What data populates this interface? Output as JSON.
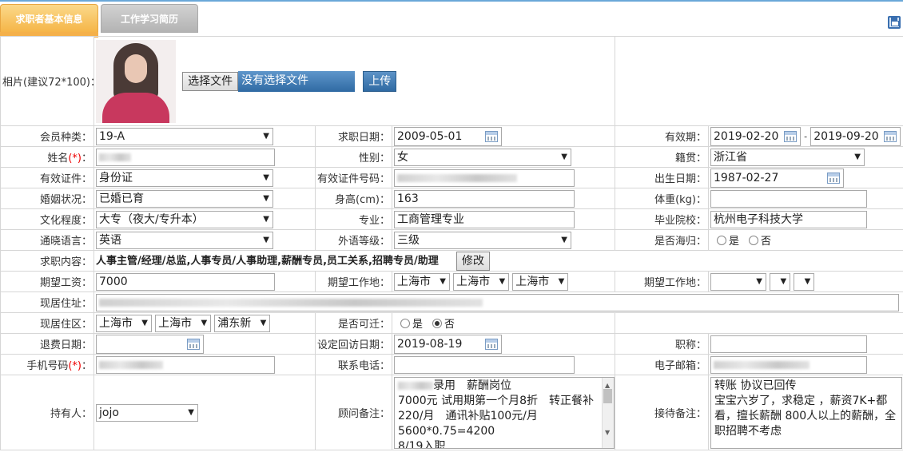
{
  "tabs": [
    "求职者基本信息",
    "工作学习简历"
  ],
  "icons": {
    "save": "save-icon",
    "calendar": "calendar-icon"
  },
  "colors": {
    "tab_active": "#f5b548",
    "tab_inactive": "#b3b3b3",
    "button_blue": "#2f6aa3",
    "required": "#e00000"
  },
  "photo": {
    "label": "相片(建议72*100)：",
    "choose_file": "选择文件",
    "no_file": "没有选择文件",
    "upload": "上传"
  },
  "labels": {
    "member_type": "会员种类：",
    "job_date": "求职日期：",
    "valid_period": "有效期：",
    "name": "姓名",
    "gender": "性别：",
    "native_place": "籍贯：",
    "id_type": "有效证件：",
    "id_number": "有效证件号码：",
    "birth_date": "出生日期：",
    "marital": "婚姻状况：",
    "height": "身高(cm)：",
    "weight": "体重(kg)：",
    "education": "文化程度：",
    "major": "专业：",
    "school": "毕业院校：",
    "language": "通晓语言：",
    "foreign_level": "外语等级：",
    "returnee": "是否海归：",
    "job_content": "求职内容：",
    "expected_salary": "期望工资：",
    "expected_location": "期望工作地：",
    "expected_location2": "期望工作地：",
    "current_address": "现居住址：",
    "current_area": "现居住区：",
    "relocatable": "是否可迁：",
    "refund_date": "退费日期：",
    "revisit_date": "设定回访日期：",
    "title": "职称：",
    "mobile": "手机号码",
    "phone": "联系电话：",
    "email": "电子邮箱：",
    "holder": "持有人：",
    "advisor_note": "顾问备注：",
    "reception_note": "接待备注：",
    "required_mark": "(*)",
    "colon": "："
  },
  "values": {
    "member_type": "19-A",
    "job_date": "2009-05-01",
    "valid_from": "2019-02-20",
    "valid_to": "2019-09-20",
    "range_sep": "-",
    "gender": "女",
    "native_place": "浙江省",
    "id_type": "身份证",
    "birth_date": "1987-02-27",
    "marital": "已婚已育",
    "height": "163",
    "education": "大专（夜大/专升本）",
    "major": "工商管理专业",
    "school": "杭州电子科技大学",
    "language": "英语",
    "foreign_level": "三级",
    "yes": "是",
    "no": "否",
    "job_content": "人事主管/经理/总监,人事专员/人事助理,薪酬专员,员工关系,招聘专员/助理",
    "modify": "修改",
    "expected_salary": "7000",
    "loc1": "上海市",
    "loc2": "上海市",
    "loc3": "上海市",
    "area1": "上海市",
    "area2": "上海市",
    "area3": "浦东新",
    "revisit_date": "2019-08-19",
    "holder": "jojo",
    "advisor_note": [
      "录用　薪酬岗位",
      "7000元 试用期第一个月8折　转正餐补220/月　通讯补贴100元/月",
      "5600*0.75=4200",
      "8/19入职"
    ],
    "reception_note": [
      "转账 协议已回传",
      "宝宝六岁了，求稳定 ，薪资7K+都看，擅长薪酬 800人以上的薪酬，全职招聘不考虑"
    ]
  }
}
